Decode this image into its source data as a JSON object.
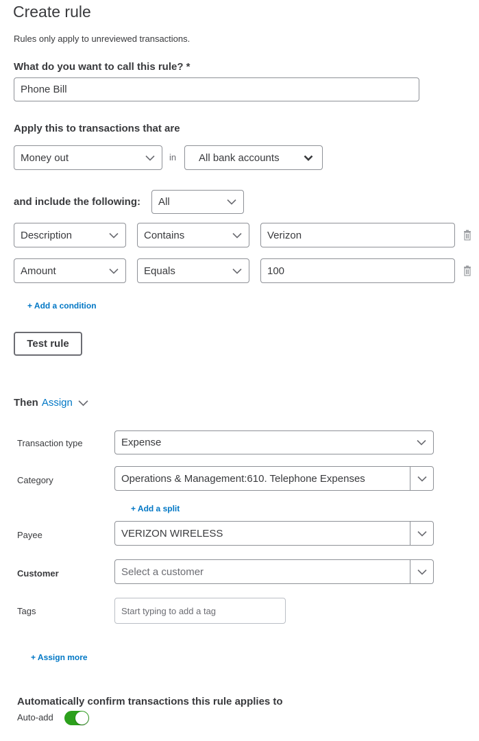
{
  "header": {
    "title": "Create rule",
    "subtitle": "Rules only apply to unreviewed transactions."
  },
  "rule_name": {
    "label": "What do you want to call this rule? *",
    "value": "Phone Bill"
  },
  "apply": {
    "label": "Apply this to transactions that are",
    "direction": "Money out",
    "in_label": "in",
    "accounts": "All bank accounts"
  },
  "include": {
    "label": "and include the following:",
    "match": "All",
    "conditions": [
      {
        "field": "Description",
        "operator": "Contains",
        "value": "Verizon"
      },
      {
        "field": "Amount",
        "operator": "Equals",
        "value": "100"
      }
    ],
    "add_condition": "+ Add a condition"
  },
  "test_rule_button": "Test rule",
  "then": {
    "label": "Then",
    "action": "Assign"
  },
  "assign": {
    "transaction_type": {
      "label": "Transaction type",
      "value": "Expense"
    },
    "category": {
      "label": "Category",
      "value": "Operations & Management:610.  Telephone Expenses"
    },
    "add_split": "+ Add a split",
    "payee": {
      "label": "Payee",
      "value": "VERIZON WIRELESS"
    },
    "customer": {
      "label": "Customer",
      "placeholder": "Select a customer"
    },
    "tags": {
      "label": "Tags",
      "placeholder": "Start typing to add a tag"
    },
    "assign_more": "+ Assign more"
  },
  "auto_confirm": {
    "label": "Automatically confirm transactions this rule applies to",
    "toggle_label": "Auto-add",
    "enabled": true
  },
  "colors": {
    "accent": "#0077c5",
    "toggle_on": "#2ca01c",
    "text": "#393a3d",
    "border": "#8d9096"
  }
}
